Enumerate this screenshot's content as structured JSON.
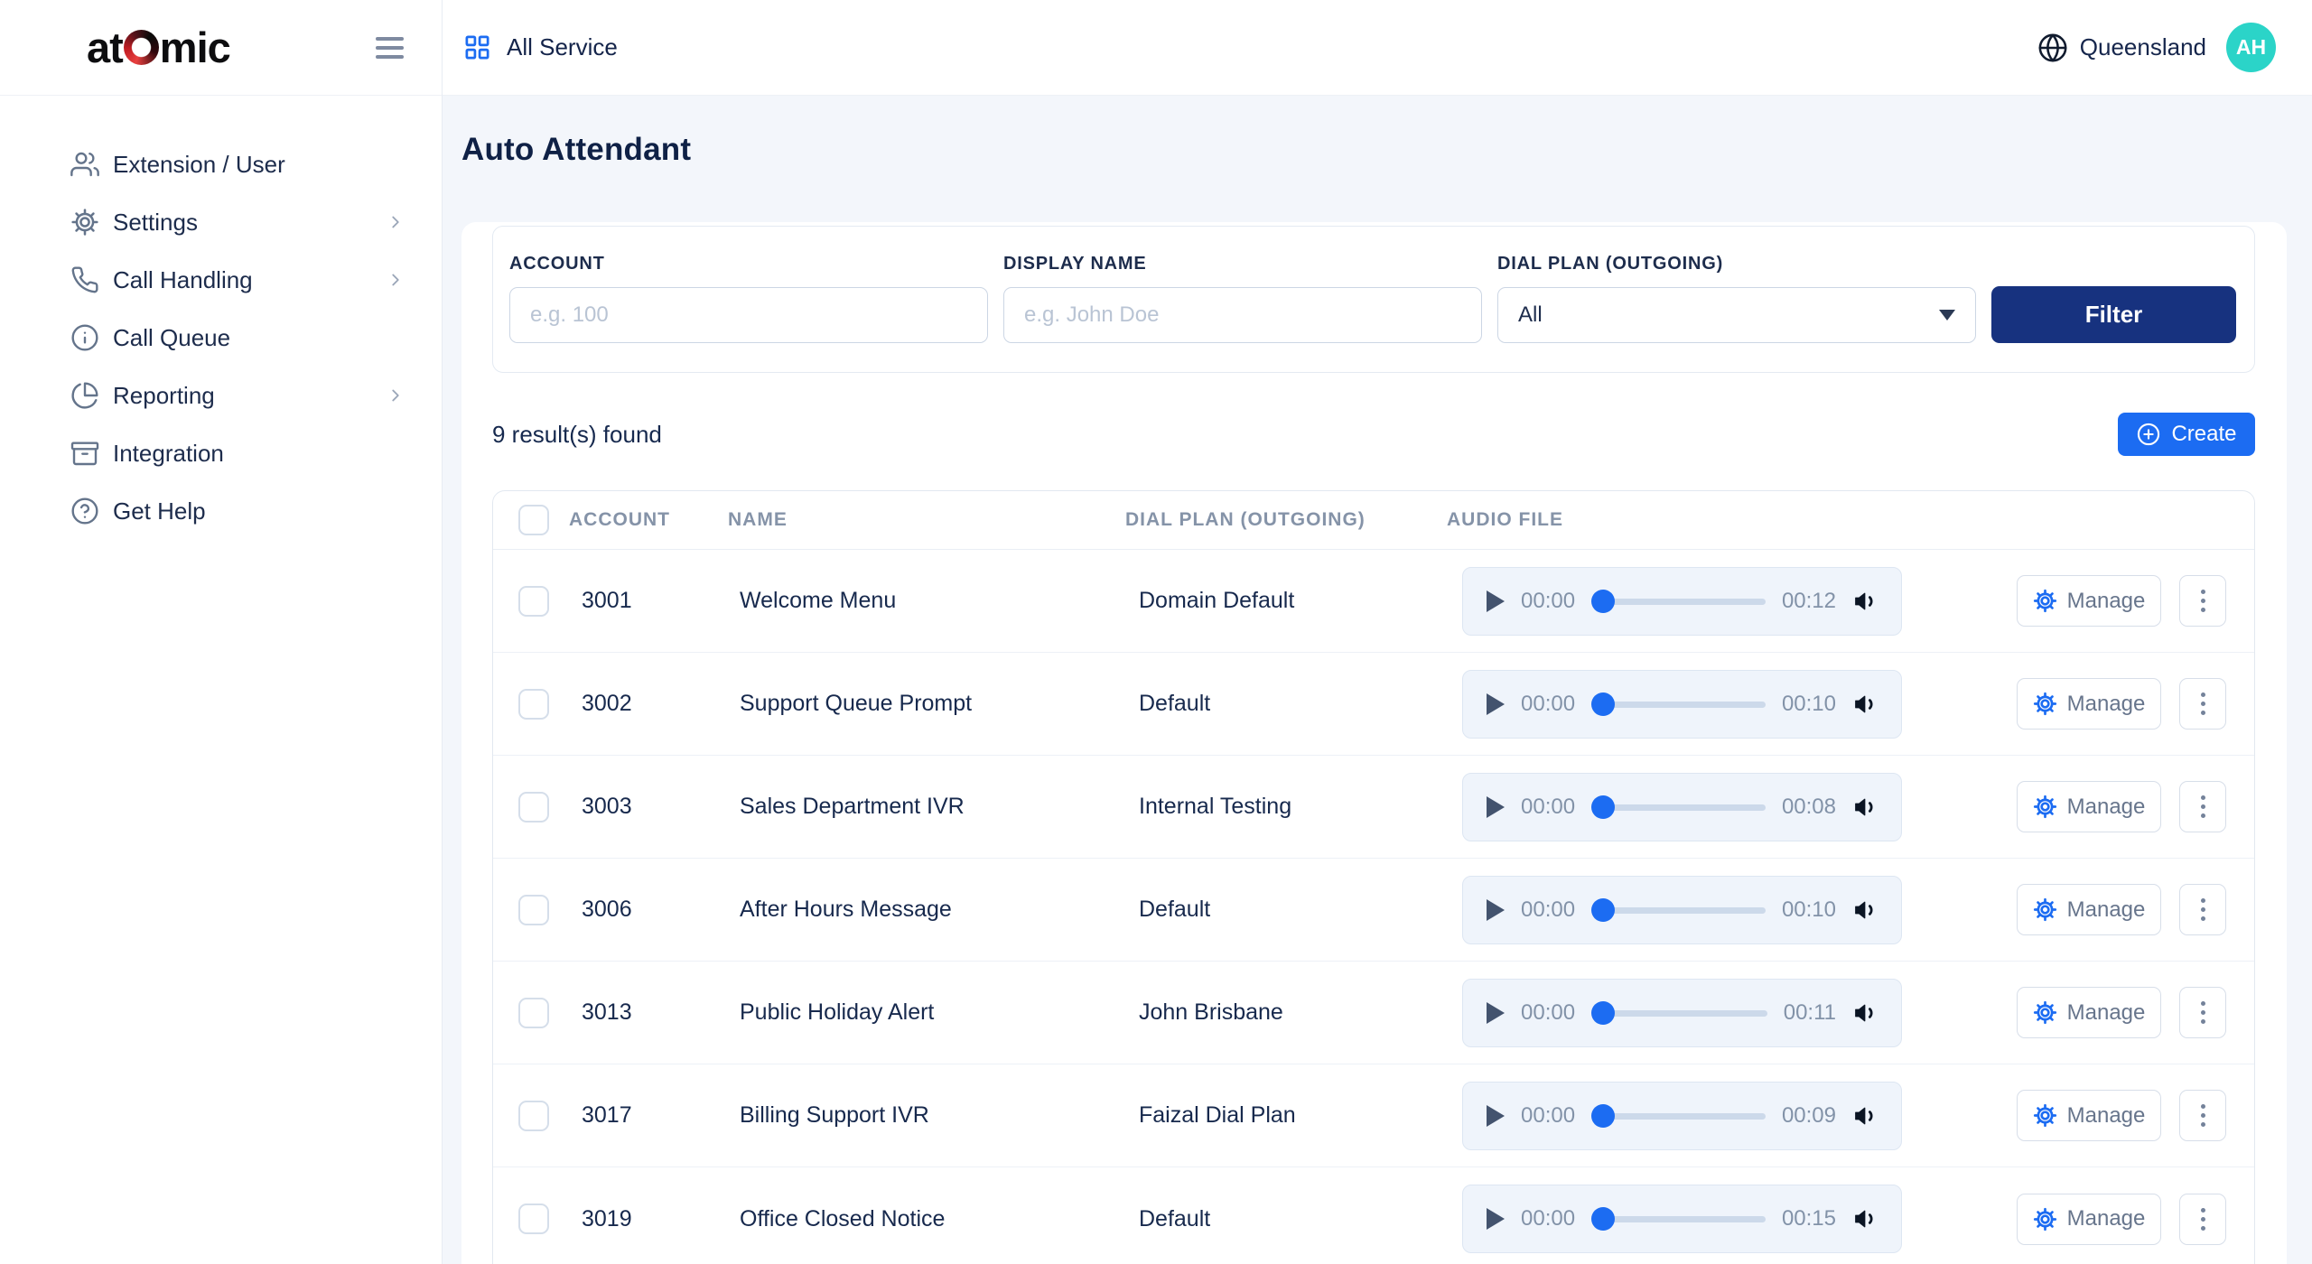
{
  "brand": {
    "name_prefix": "at",
    "name_suffix": "mic"
  },
  "topbar": {
    "service_label": "All Service",
    "region": "Queensland",
    "avatar_initials": "AH"
  },
  "sidebar": {
    "items": [
      {
        "label": "Extension / User",
        "icon": "users-icon",
        "has_submenu": false
      },
      {
        "label": "Settings",
        "icon": "gear-icon",
        "has_submenu": true
      },
      {
        "label": "Call Handling",
        "icon": "phone-icon",
        "has_submenu": true
      },
      {
        "label": "Call Queue",
        "icon": "info-icon",
        "has_submenu": false
      },
      {
        "label": "Reporting",
        "icon": "pie-chart-icon",
        "has_submenu": true
      },
      {
        "label": "Integration",
        "icon": "archive-icon",
        "has_submenu": false
      },
      {
        "label": "Get Help",
        "icon": "help-icon",
        "has_submenu": false
      }
    ]
  },
  "page": {
    "title": "Auto Attendant"
  },
  "filters": {
    "account": {
      "label": "ACCOUNT",
      "placeholder": "e.g. 100",
      "value": ""
    },
    "display_name": {
      "label": "DISPLAY NAME",
      "placeholder": "e.g. John Doe",
      "value": ""
    },
    "dial_plan": {
      "label": "DIAL PLAN (OUTGOING)",
      "value": "All"
    },
    "submit_label": "Filter"
  },
  "results": {
    "summary": "9 result(s) found",
    "create_label": "Create"
  },
  "table": {
    "headers": [
      "ACCOUNT",
      "NAME",
      "DIAL PLAN (OUTGOING)",
      "AUDIO FILE"
    ],
    "manage_label": "Manage",
    "rows": [
      {
        "account": "3001",
        "name": "Welcome Menu",
        "dial_plan": "Domain Default",
        "current_time": "00:00",
        "duration": "00:12"
      },
      {
        "account": "3002",
        "name": "Support Queue Prompt",
        "dial_plan": "Default",
        "current_time": "00:00",
        "duration": "00:10"
      },
      {
        "account": "3003",
        "name": "Sales Department IVR",
        "dial_plan": "Internal Testing",
        "current_time": "00:00",
        "duration": "00:08"
      },
      {
        "account": "3006",
        "name": "After Hours Message",
        "dial_plan": "Default",
        "current_time": "00:00",
        "duration": "00:10"
      },
      {
        "account": "3013",
        "name": "Public Holiday Alert",
        "dial_plan": "John Brisbane",
        "current_time": "00:00",
        "duration": "00:11"
      },
      {
        "account": "3017",
        "name": "Billing Support IVR",
        "dial_plan": "Faizal Dial Plan",
        "current_time": "00:00",
        "duration": "00:09"
      },
      {
        "account": "3019",
        "name": "Office Closed Notice",
        "dial_plan": "Default",
        "current_time": "00:00",
        "duration": "00:15"
      }
    ]
  },
  "colors": {
    "accent_blue": "#1c6cf2",
    "deep_blue": "#17327f",
    "avatar_teal": "#2bd4c8",
    "logo_red": "#d8232a",
    "navy_text": "#14254a",
    "page_bg": "#f3f6fb"
  }
}
